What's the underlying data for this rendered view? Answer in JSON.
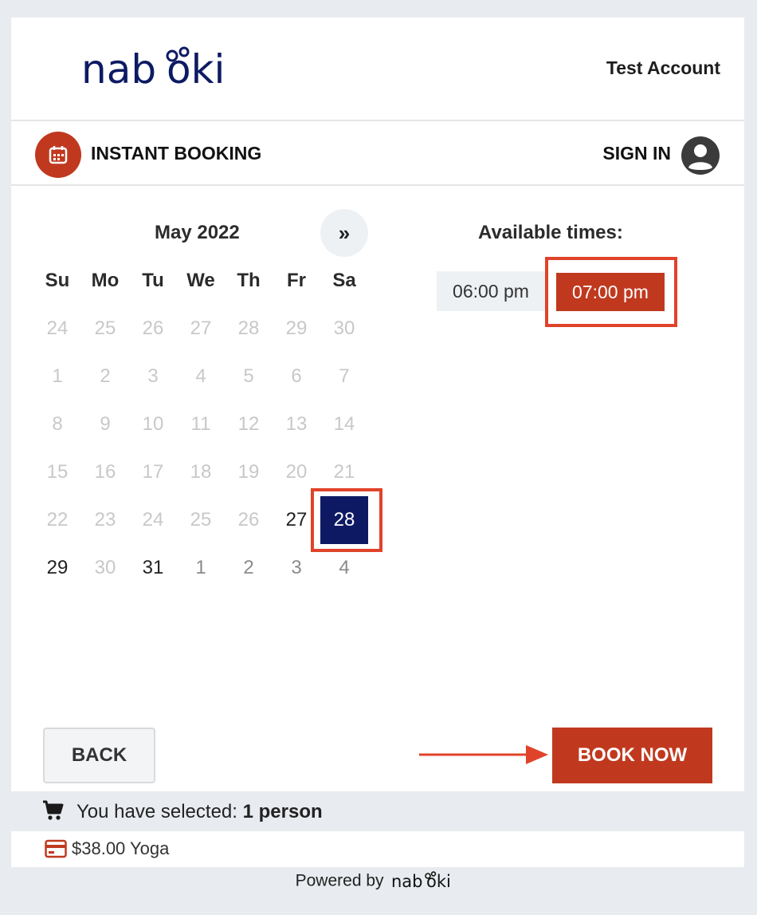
{
  "header": {
    "logo_alt": "nabooki",
    "account": "Test Account"
  },
  "subbar": {
    "title": "INSTANT BOOKING",
    "sign_in": "SIGN IN"
  },
  "calendar": {
    "month": "May 2022",
    "next": "»",
    "dow": [
      "Su",
      "Mo",
      "Tu",
      "We",
      "Th",
      "Fr",
      "Sa"
    ],
    "weeks": [
      [
        {
          "d": "24",
          "s": "muted"
        },
        {
          "d": "25",
          "s": "muted"
        },
        {
          "d": "26",
          "s": "muted"
        },
        {
          "d": "27",
          "s": "muted"
        },
        {
          "d": "28",
          "s": "muted"
        },
        {
          "d": "29",
          "s": "muted"
        },
        {
          "d": "30",
          "s": "muted"
        }
      ],
      [
        {
          "d": "1",
          "s": "muted"
        },
        {
          "d": "2",
          "s": "muted"
        },
        {
          "d": "3",
          "s": "muted"
        },
        {
          "d": "4",
          "s": "muted"
        },
        {
          "d": "5",
          "s": "muted"
        },
        {
          "d": "6",
          "s": "muted"
        },
        {
          "d": "7",
          "s": "muted"
        }
      ],
      [
        {
          "d": "8",
          "s": "muted"
        },
        {
          "d": "9",
          "s": "muted"
        },
        {
          "d": "10",
          "s": "muted"
        },
        {
          "d": "11",
          "s": "muted"
        },
        {
          "d": "12",
          "s": "muted"
        },
        {
          "d": "13",
          "s": "muted"
        },
        {
          "d": "14",
          "s": "muted"
        }
      ],
      [
        {
          "d": "15",
          "s": "muted"
        },
        {
          "d": "16",
          "s": "muted"
        },
        {
          "d": "17",
          "s": "muted"
        },
        {
          "d": "18",
          "s": "muted"
        },
        {
          "d": "19",
          "s": "muted"
        },
        {
          "d": "20",
          "s": "muted"
        },
        {
          "d": "21",
          "s": "muted"
        }
      ],
      [
        {
          "d": "22",
          "s": "muted"
        },
        {
          "d": "23",
          "s": "muted"
        },
        {
          "d": "24",
          "s": "muted"
        },
        {
          "d": "25",
          "s": "muted"
        },
        {
          "d": "26",
          "s": "muted"
        },
        {
          "d": "27",
          "s": "avail"
        },
        {
          "d": "28",
          "s": "selected"
        }
      ],
      [
        {
          "d": "29",
          "s": "avail"
        },
        {
          "d": "30",
          "s": "muted"
        },
        {
          "d": "31",
          "s": "avail"
        },
        {
          "d": "1",
          "s": "other"
        },
        {
          "d": "2",
          "s": "other"
        },
        {
          "d": "3",
          "s": "other"
        },
        {
          "d": "4",
          "s": "other"
        }
      ]
    ]
  },
  "times": {
    "title": "Available times:",
    "slots": [
      "06:00 pm",
      "07:00 pm"
    ]
  },
  "actions": {
    "back": "BACK",
    "book": "BOOK NOW"
  },
  "cart": {
    "prefix": "You have selected: ",
    "bold": "1 person"
  },
  "price": {
    "text": "$38.00 Yoga"
  },
  "footer": {
    "powered": "Powered by"
  },
  "colors": {
    "brand_navy": "#0d1a63",
    "accent_red": "#c0391f",
    "highlight": "#e0432a"
  }
}
